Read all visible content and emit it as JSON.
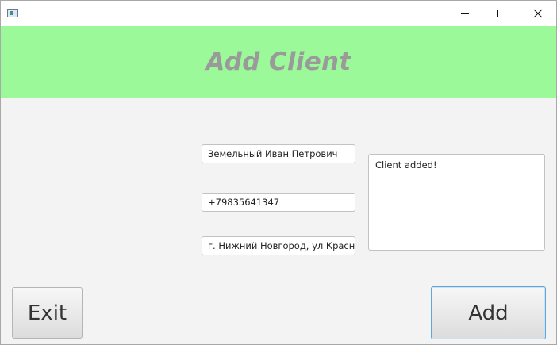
{
  "window": {
    "controls": {
      "minimize_icon": "minimize-icon",
      "maximize_icon": "maximize-icon",
      "close_icon": "close-icon"
    }
  },
  "header": {
    "title": "Add Client",
    "background": "#9cf99a",
    "title_color": "#9a9a9a"
  },
  "form": {
    "name_value": "Земельный Иван Петрович",
    "phone_value": "+79835641347",
    "address_value": "г. Нижний Новгород, ул Красное"
  },
  "output": {
    "text": "Client added!"
  },
  "buttons": {
    "exit_label": "Exit",
    "add_label": "Add"
  }
}
